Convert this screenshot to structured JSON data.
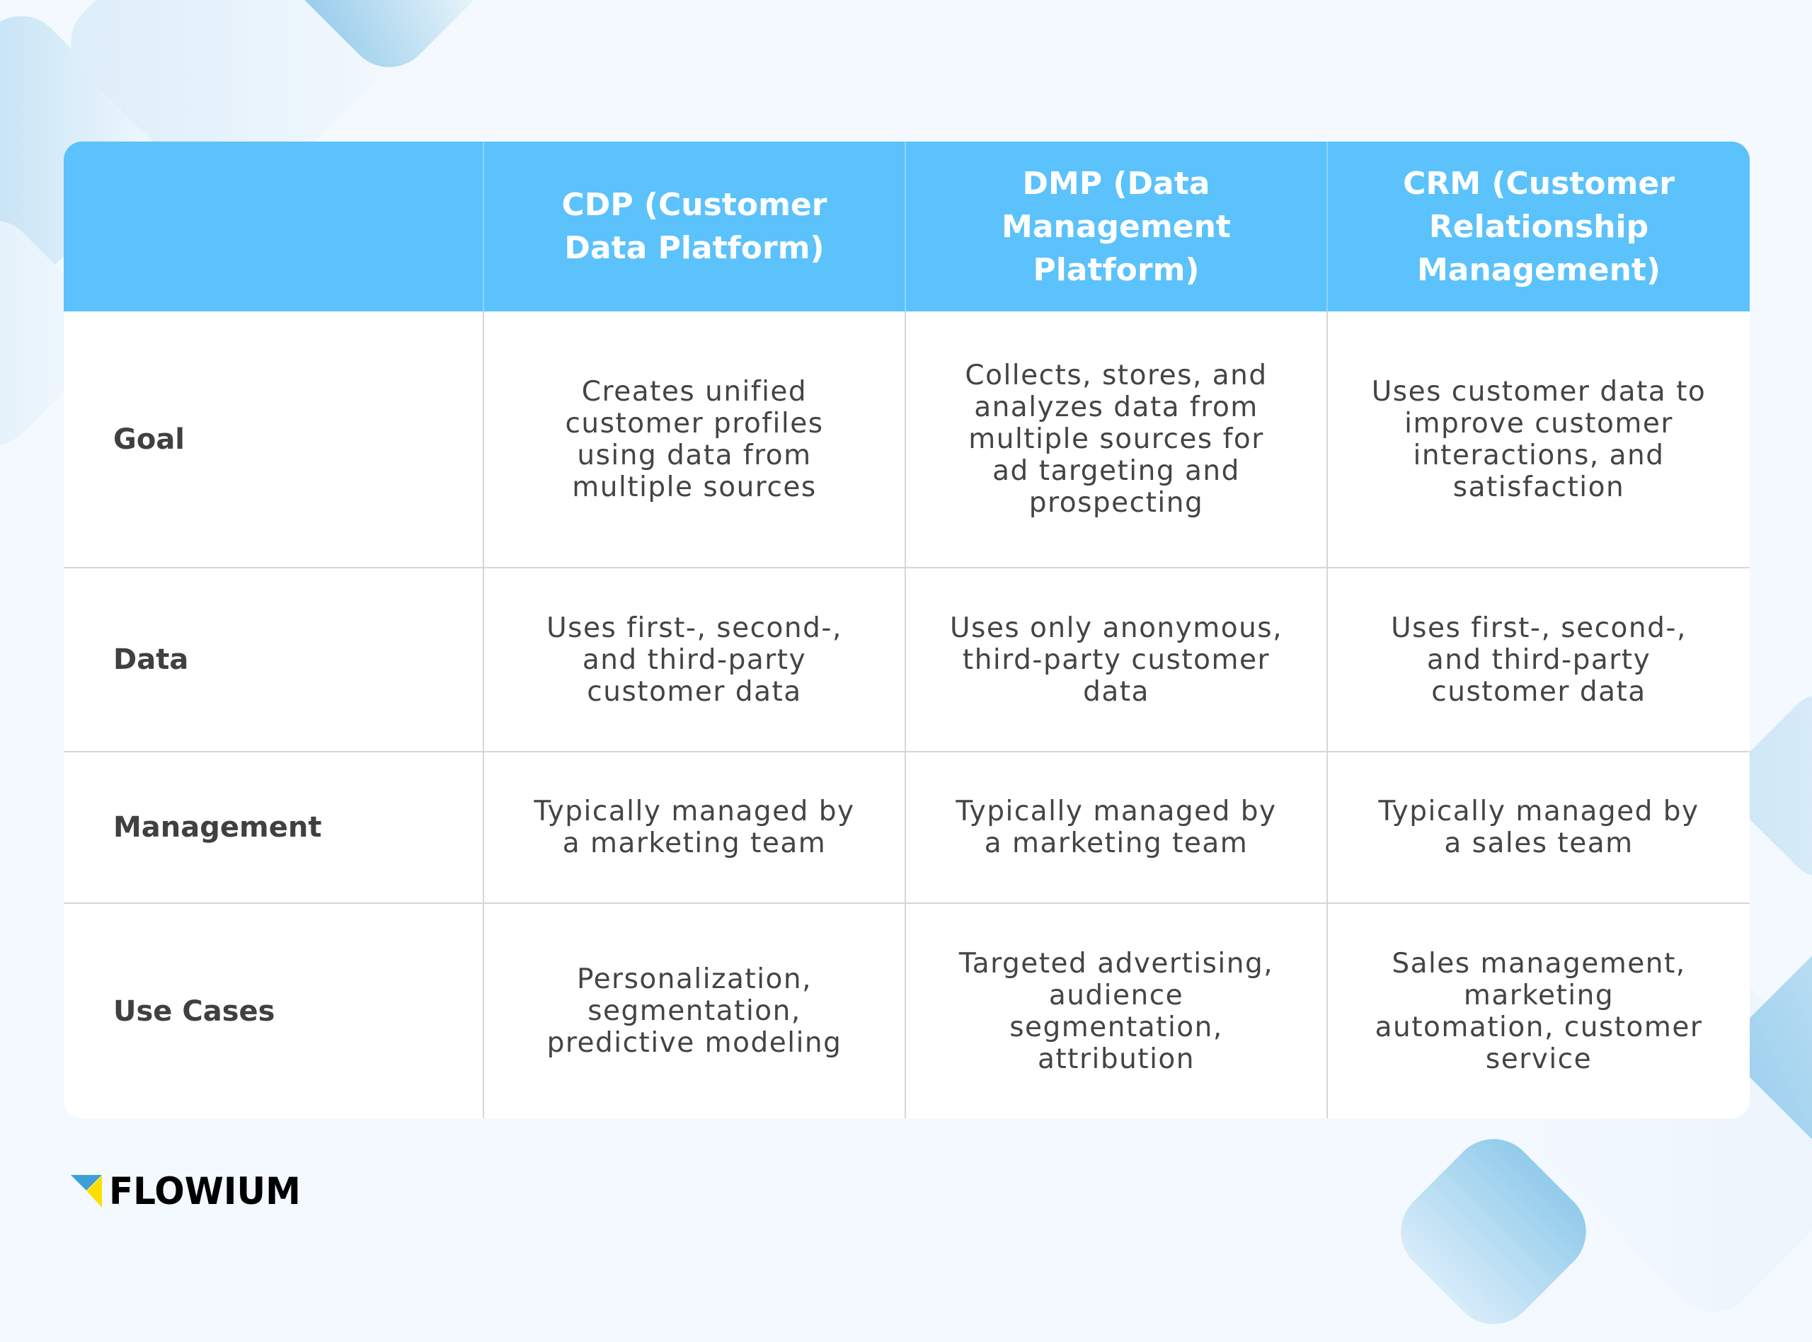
{
  "colors": {
    "header_bg": "#5BC2FC",
    "header_text": "#FFFFFF",
    "body_text": "#444444",
    "page_bg": "#F3F9FE",
    "logo_blue": "#3C9FD8",
    "logo_yellow": "#FFDD00"
  },
  "table": {
    "columns": [
      "",
      "CDP (Customer Data Platform)",
      "DMP (Data Management Platform)",
      "CRM (Customer Relationship Management)"
    ],
    "rows": [
      {
        "label": "Goal",
        "cells": [
          "Creates unified customer profiles using data from multiple sources",
          "Collects, stores, and analyzes data from multiple sources for ad targeting and prospecting",
          "Uses customer data to improve customer interactions, and satisfaction"
        ]
      },
      {
        "label": "Data",
        "cells": [
          "Uses first-, second-, and third-party customer data",
          "Uses only anonymous, third-party customer data",
          "Uses first-, second-, and third-party customer data"
        ]
      },
      {
        "label": "Management",
        "cells": [
          "Typically managed by a marketing team",
          "Typically managed by a marketing team",
          "Typically managed by a sales team"
        ]
      },
      {
        "label": "Use Cases",
        "cells": [
          "Personalization, segmentation, predictive modeling",
          "Targeted advertising, audience segmentation, attribution",
          "Sales management, marketing automation, customer service"
        ]
      }
    ]
  },
  "logo": {
    "text": "FLOWIUM",
    "icon": "flowium-triangle-logo-icon"
  }
}
